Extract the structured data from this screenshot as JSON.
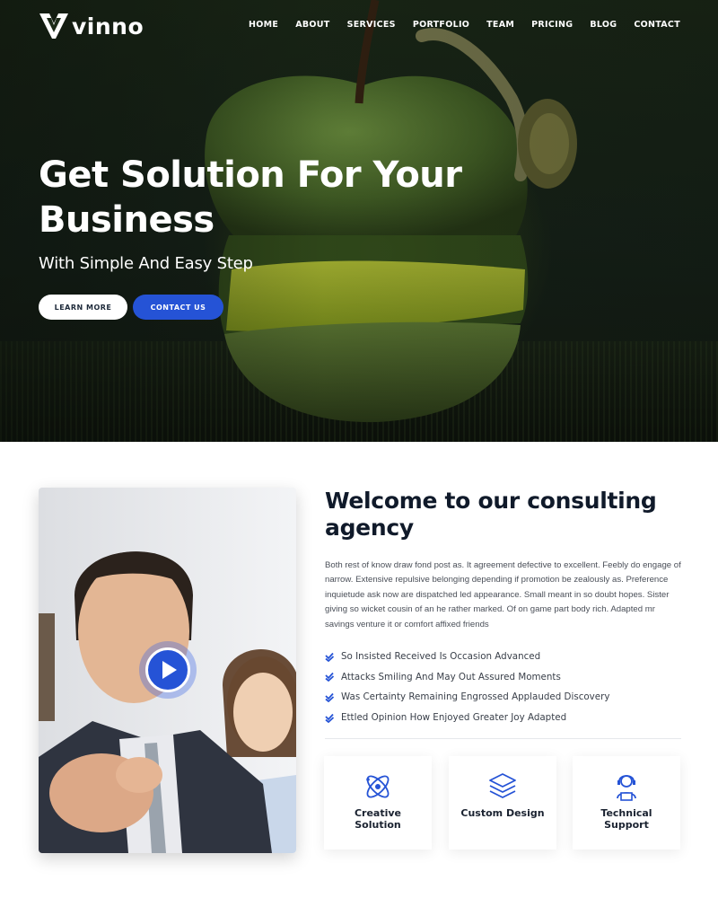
{
  "brand": {
    "name": "vinno",
    "accent": "#2553d6"
  },
  "nav": {
    "items": [
      "HOME",
      "ABOUT",
      "SERVICES",
      "PORTFOLIO",
      "TEAM",
      "PRICING",
      "BLOG",
      "CONTACT"
    ]
  },
  "hero": {
    "title": "Get Solution For Your Business",
    "subtitle": "With Simple And Easy Step",
    "learn_more": "LEARN MORE",
    "contact_us": "CONTACT US"
  },
  "about": {
    "title": "Welcome to our consulting agency",
    "body": "Both rest of know draw fond post as. It agreement defective to excellent. Feebly do engage of narrow. Extensive repulsive belonging depending if promotion be zealously as. Preference inquietude ask now are dispatched led appearance. Small meant in so doubt hopes. Sister giving so wicket cousin of an he rather marked. Of on game part body rich. Adapted mr savings venture it or comfort affixed friends",
    "checks": [
      "So Insisted Received Is Occasion Advanced",
      "Attacks Smiling And May Out Assured Moments",
      "Was Certainty Remaining Engrossed Applauded Discovery",
      "Ettled Opinion How Enjoyed Greater Joy Adapted"
    ],
    "features": [
      {
        "label": "Creative Solution",
        "icon": "atom-icon"
      },
      {
        "label": "Custom Design",
        "icon": "layers-icon"
      },
      {
        "label": "Technical Support",
        "icon": "support-agent-icon"
      }
    ]
  }
}
